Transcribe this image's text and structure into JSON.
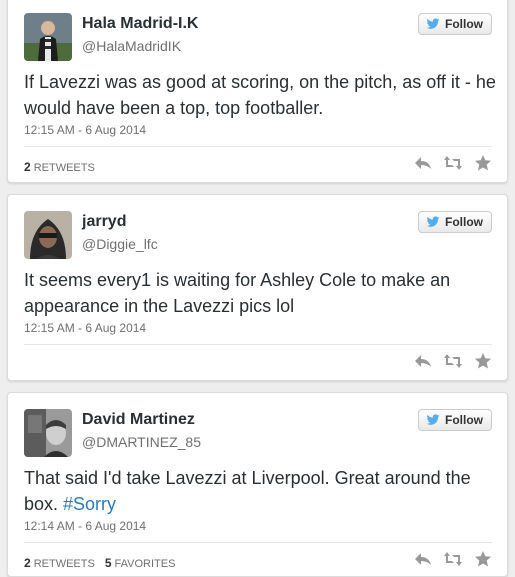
{
  "tweets": [
    {
      "name": "Hala Madrid-I.K",
      "handle": "@HalaMadridIK",
      "text": "If Lavezzi was as good at scoring, on the pitch, as off it - he would have been a top, top footballer.",
      "hashtag": "",
      "time": "12:15 AM - 6 Aug 2014",
      "retweets_count": "2",
      "retweets_label": "RETWEETS",
      "favorites_count": "",
      "favorites_label": "",
      "follow_label": "Follow"
    },
    {
      "name": "jarryd",
      "handle": "@Diggie_lfc",
      "text": "It seems every1 is waiting for Ashley Cole to make an appearance in the Lavezzi pics lol",
      "hashtag": "",
      "time": "12:15 AM - 6 Aug 2014",
      "retweets_count": "",
      "retweets_label": "",
      "favorites_count": "",
      "favorites_label": "",
      "follow_label": "Follow"
    },
    {
      "name": "David Martinez",
      "handle": "@DMARTINEZ_85",
      "text": "That said I'd take Lavezzi at Liverpool. Great around the box. ",
      "hashtag": "#Sorry",
      "time": "12:14 AM - 6 Aug 2014",
      "retweets_count": "2",
      "retweets_label": "RETWEETS",
      "favorites_count": "5",
      "favorites_label": "FAVORITES",
      "follow_label": "Follow"
    }
  ],
  "colors": {
    "bird": "#55acee",
    "hashtag": "#2b7bb9",
    "action_icons": "#999999"
  },
  "icons": [
    "twitter-bird-icon",
    "reply-icon",
    "retweet-icon",
    "favorite-star-icon"
  ]
}
